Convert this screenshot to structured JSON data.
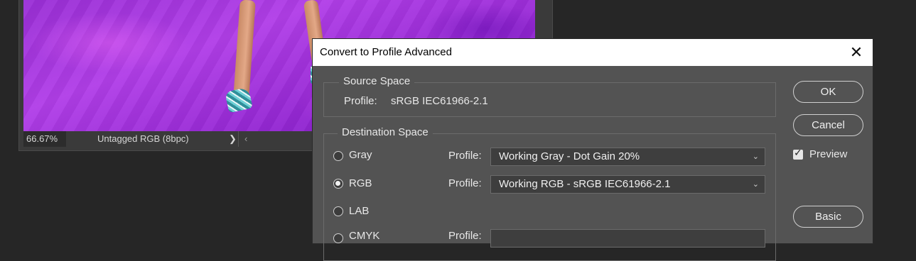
{
  "document": {
    "zoom": "66.67%",
    "profile_status": "Untagged RGB (8bpc)",
    "status_arrow": "❯",
    "scroll_left": "‹"
  },
  "dialog": {
    "title": "Convert to Profile Advanced",
    "close_glyph": "✕",
    "source": {
      "title": "Source Space",
      "profile_label": "Profile:",
      "profile_value": "sRGB IEC61966-2.1"
    },
    "destination": {
      "title": "Destination Space",
      "options": [
        {
          "label": "Gray",
          "selected": false,
          "profile_label": "Profile:",
          "profile_value": "Working Gray - Dot Gain 20%"
        },
        {
          "label": "RGB",
          "selected": true,
          "profile_label": "Profile:",
          "profile_value": "Working RGB - sRGB IEC61966-2.1"
        },
        {
          "label": "LAB",
          "selected": false
        },
        {
          "label": "CMYK",
          "selected": false,
          "profile_label": "Profile:"
        }
      ]
    },
    "buttons": {
      "ok": "OK",
      "cancel": "Cancel",
      "basic": "Basic"
    },
    "preview": {
      "label": "Preview",
      "checked": true
    },
    "chevron": "⌄"
  }
}
